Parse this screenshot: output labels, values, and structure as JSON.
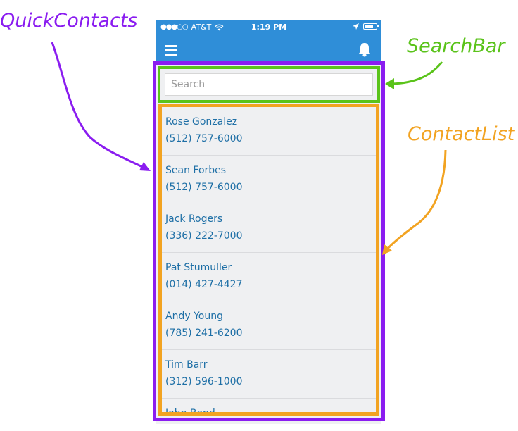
{
  "status_bar": {
    "carrier": "AT&T",
    "time": "1:19 PM"
  },
  "annotations": {
    "quick_contacts": "QuickContacts",
    "search_bar": "SearchBar",
    "contact_list": "ContactList"
  },
  "search": {
    "placeholder": "Search"
  },
  "contacts": [
    {
      "name": "Rose Gonzalez",
      "phone": "(512) 757-6000"
    },
    {
      "name": "Sean Forbes",
      "phone": "(512) 757-6000"
    },
    {
      "name": "Jack Rogers",
      "phone": "(336) 222-7000"
    },
    {
      "name": "Pat Stumuller",
      "phone": "(014) 427-4427"
    },
    {
      "name": "Andy Young",
      "phone": "(785) 241-6200"
    },
    {
      "name": "Tim Barr",
      "phone": "(312) 596-1000"
    },
    {
      "name": "John Bond",
      "phone": ""
    }
  ],
  "colors": {
    "quick_contacts": "#8a1cf0",
    "search_bar": "#5ac31a",
    "contact_list": "#f2a321",
    "app_bar": "#2f8ed8",
    "contact_text": "#1e6fa6"
  },
  "icons": [
    "signal-dots-icon",
    "wifi-icon",
    "location-arrow-icon",
    "battery-icon",
    "hamburger-menu-icon",
    "bell-icon"
  ]
}
